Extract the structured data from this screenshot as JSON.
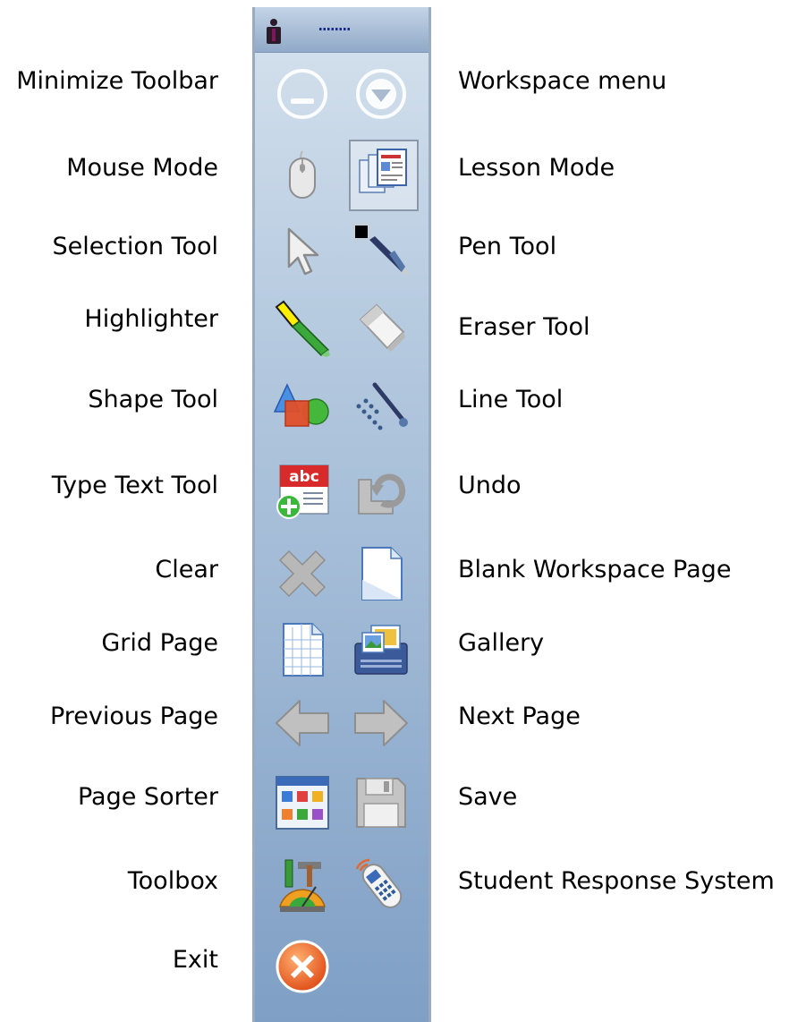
{
  "labels": {
    "minimize_toolbar": "Minimize Toolbar",
    "workspace_menu": "Workspace menu",
    "mouse_mode": "Mouse Mode",
    "lesson_mode": "Lesson Mode",
    "selection_tool": "Selection Tool",
    "pen_tool": "Pen Tool",
    "highlighter": "Highlighter",
    "eraser_tool": "Eraser Tool",
    "shape_tool": "Shape Tool",
    "line_tool": "Line Tool",
    "type_text_tool": "Type Text Tool",
    "undo": "Undo",
    "clear": "Clear",
    "blank_workspace_page": "Blank Workspace Page",
    "grid_page": "Grid Page",
    "gallery": "Gallery",
    "previous_page": "Previous Page",
    "next_page": "Next Page",
    "page_sorter": "Page Sorter",
    "save": "Save",
    "toolbox": "Toolbox",
    "student_response_system": "Student Response System",
    "exit": "Exit"
  },
  "icon_text": {
    "abc": "abc"
  },
  "toolbar": {
    "active_button": "lesson-mode",
    "colors": {
      "top": "#d6e2ee",
      "bottom": "#7f9fc5",
      "frame": "#9aabc0"
    }
  }
}
